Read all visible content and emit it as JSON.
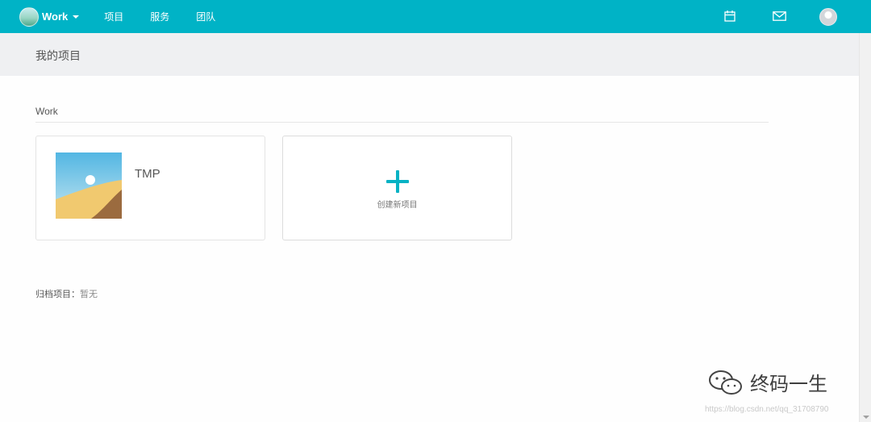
{
  "navbar": {
    "brand": "Work",
    "items": [
      "项目",
      "服务",
      "团队"
    ],
    "accent_color": "#00b3c6",
    "right_icons": [
      "calendar-icon",
      "mail-icon",
      "avatar"
    ]
  },
  "page": {
    "title": "我的项目"
  },
  "group": {
    "title": "Work",
    "projects": [
      {
        "name": "TMP"
      }
    ],
    "create_label": "创建新项目"
  },
  "archive": {
    "label": "归档项目：",
    "value": "暂无"
  },
  "watermark": {
    "brand": "终码一生",
    "url": "https://blog.csdn.net/qq_31708790"
  }
}
